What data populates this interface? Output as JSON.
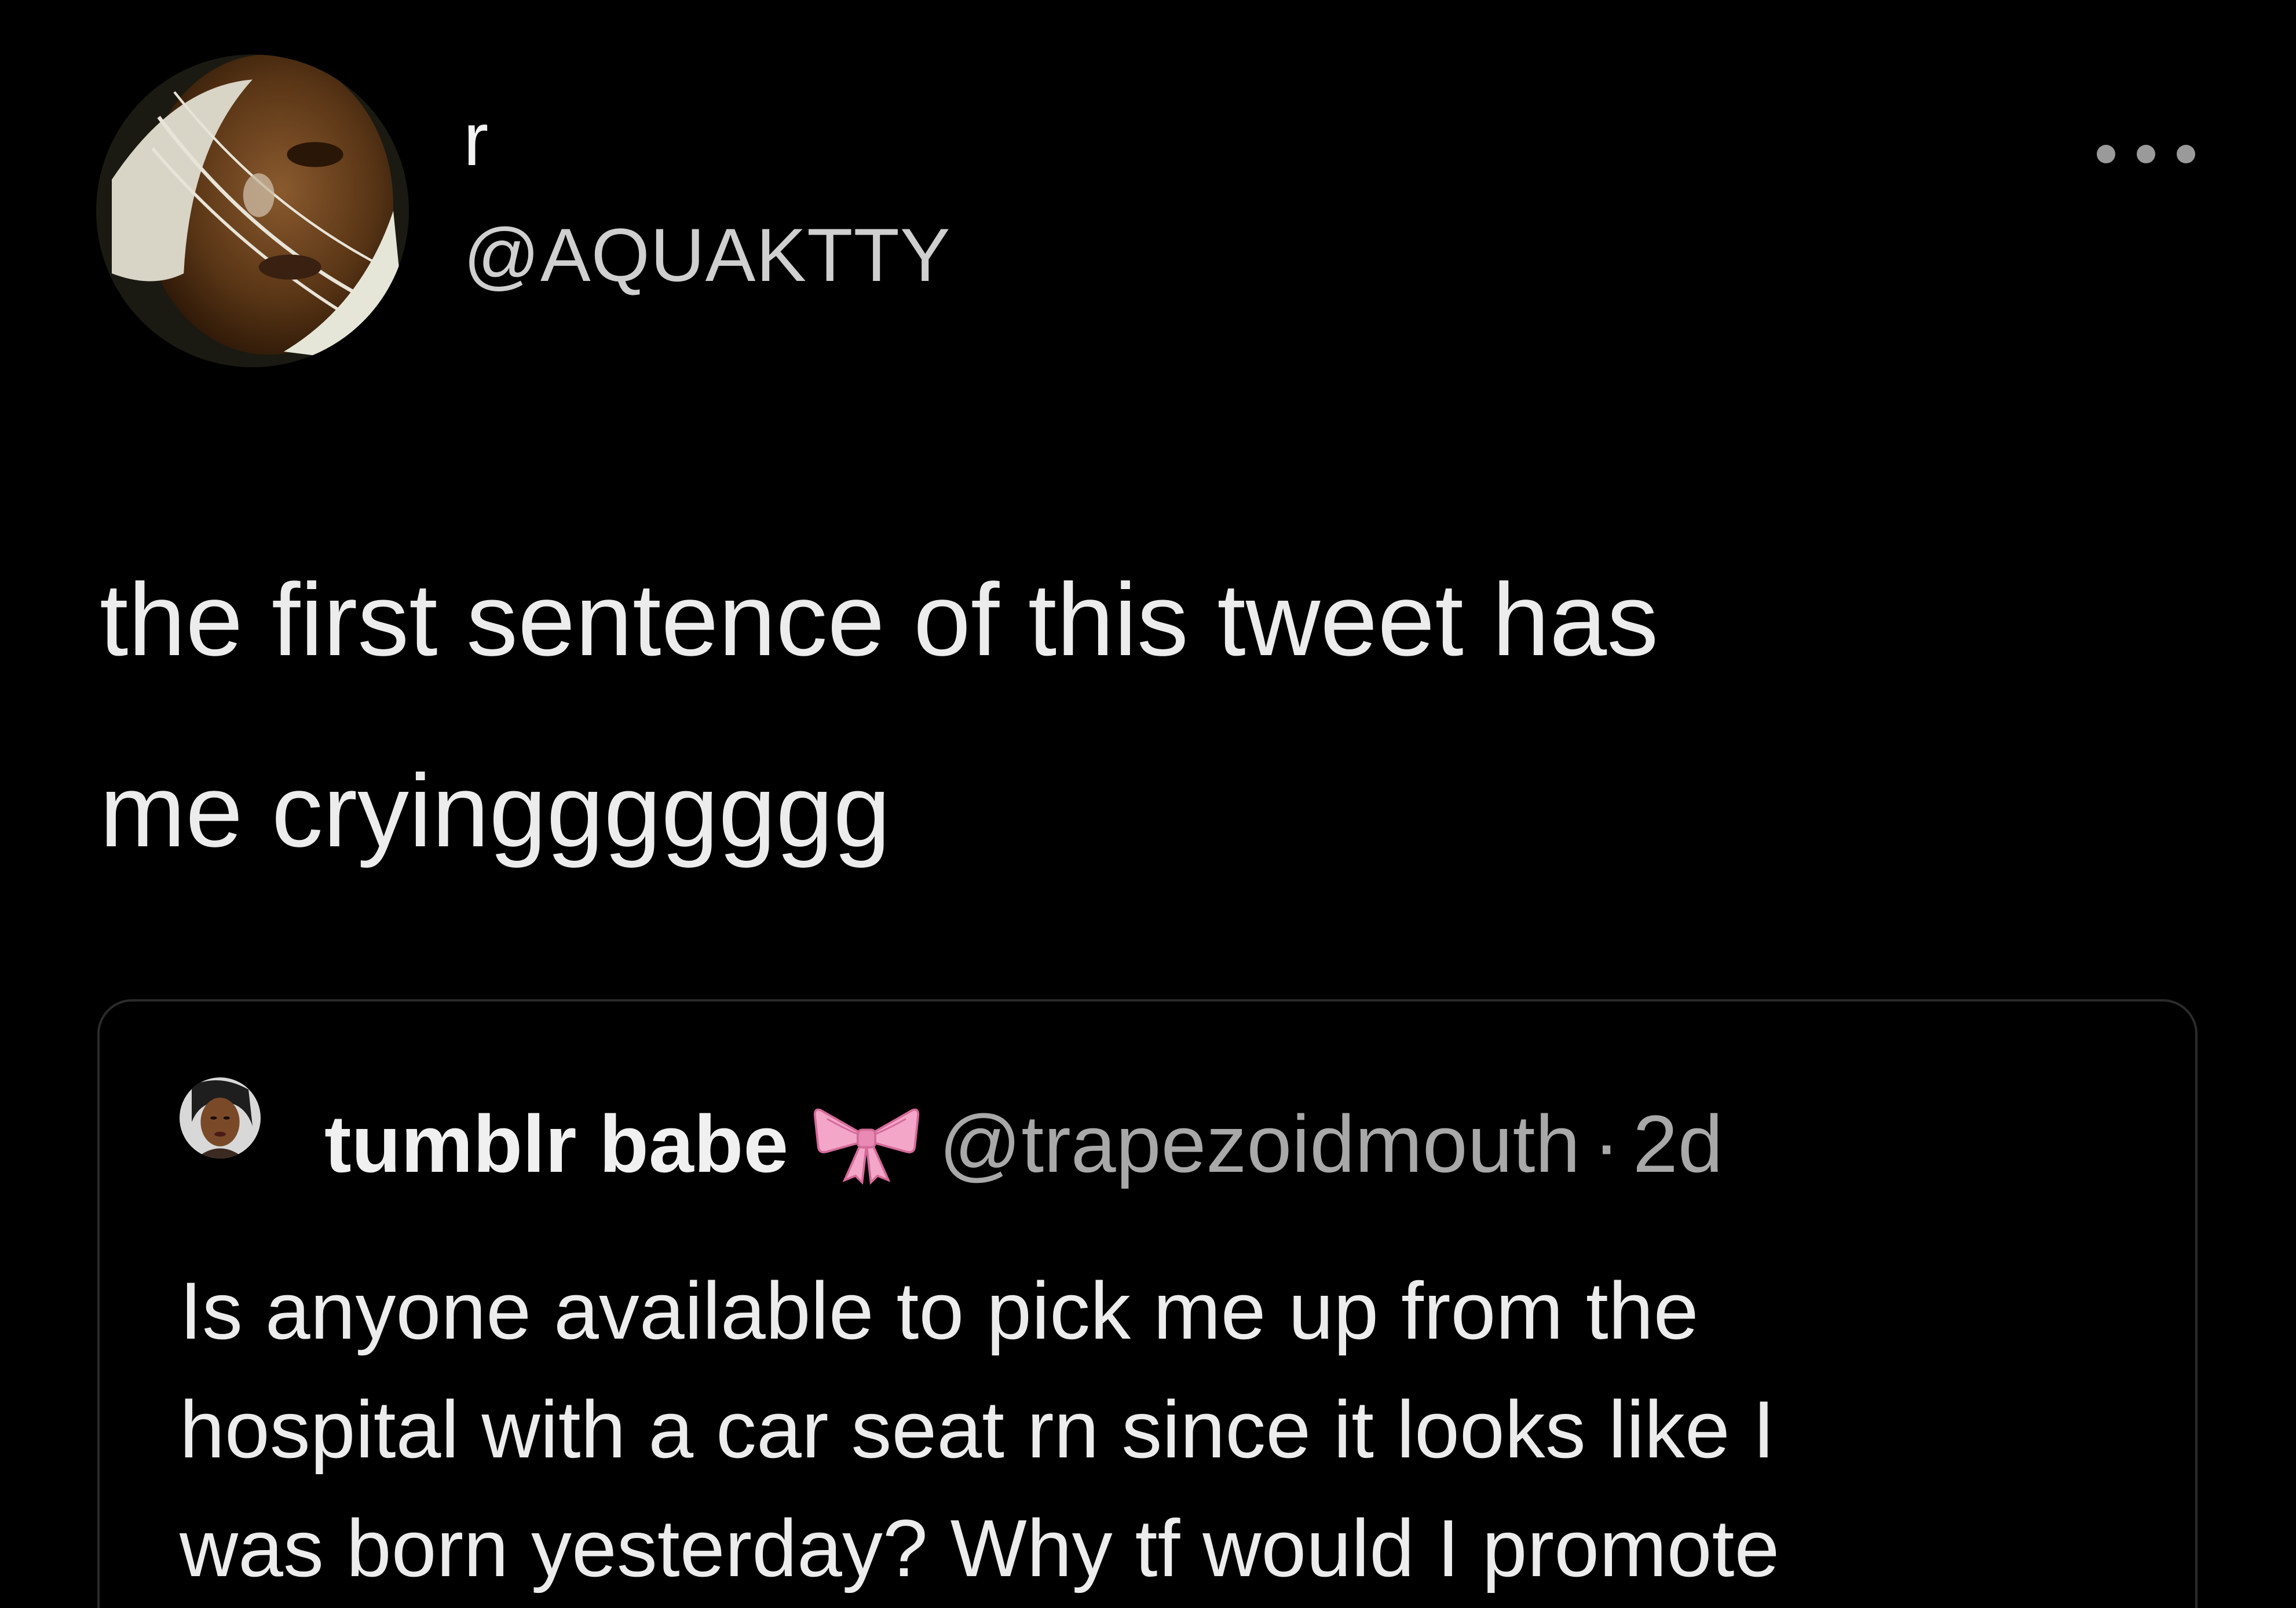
{
  "tweet": {
    "author": {
      "display_name": "r",
      "handle": "@AQUAKTTY",
      "avatar_icon": "profile-photo"
    },
    "more_icon": "more-horizontal-icon",
    "text_line_1": "the first sentence of this tweet has",
    "text_line_2": "me cryinggggggg"
  },
  "quoted_tweet": {
    "author": {
      "display_name": "tumblr babe",
      "emoji": "pink-bow",
      "handle": "@trapezoidmouth",
      "separator": "·",
      "time": "2d"
    },
    "text_line_1": "Is anyone available to pick me up from the",
    "text_line_2": "hospital with a car seat rn since it looks like I",
    "text_line_3": "was born yesterday? Why tf would I promote"
  },
  "colors": {
    "background": "#000000",
    "text_primary": "#ececec",
    "text_secondary": "#a8a8a8",
    "card_border": "#2b2b2b",
    "bow_pink": "#f3a6c8"
  }
}
